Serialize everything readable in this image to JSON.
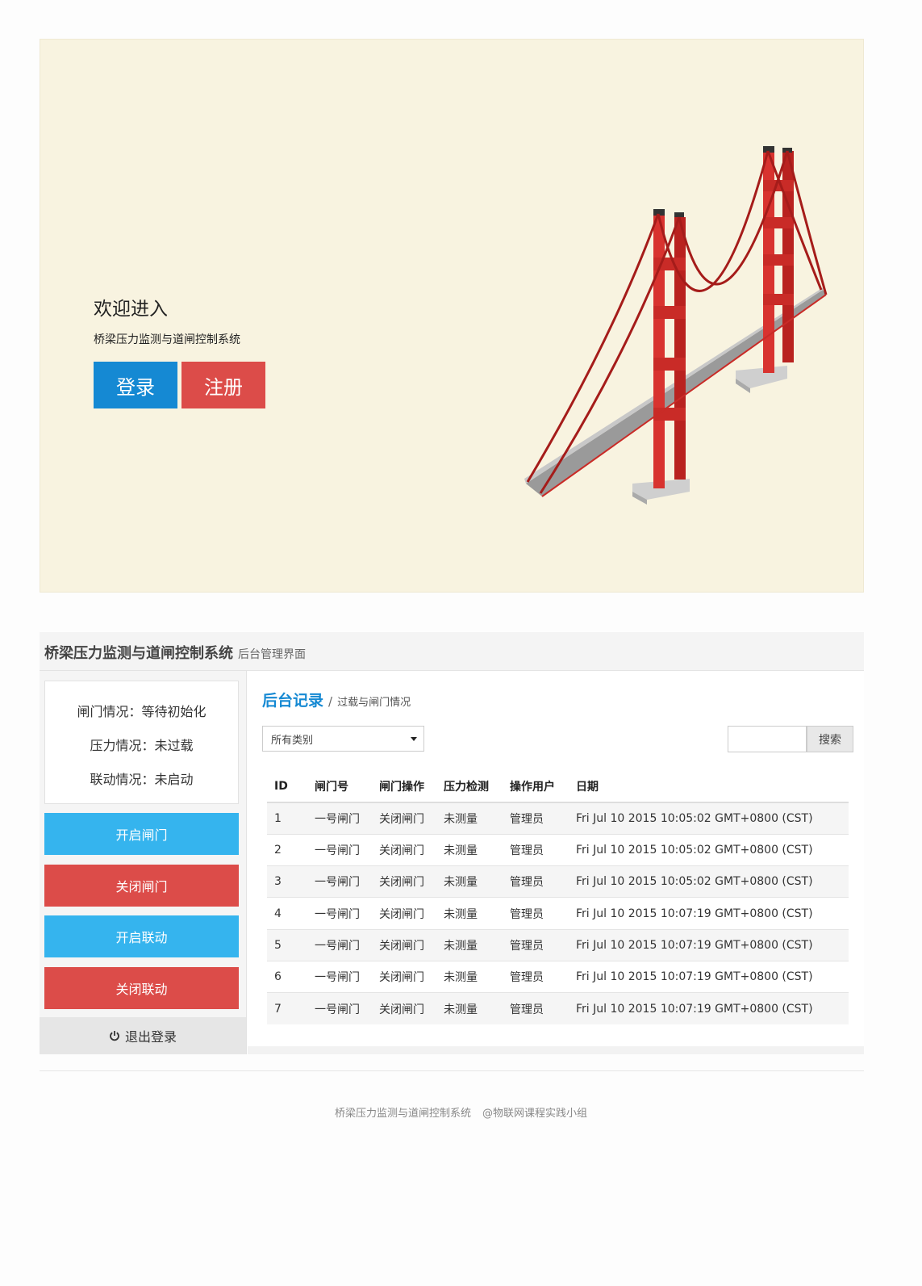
{
  "hero": {
    "title": "欢迎进入",
    "subtitle": "桥梁压力监测与道闸控制系统",
    "login_label": "登录",
    "register_label": "注册"
  },
  "admin": {
    "title": "桥梁压力监测与道闸控制系统",
    "subtitle": "后台管理界面",
    "status": {
      "gate": "闸门情况：等待初始化",
      "pressure": "压力情况：未过载",
      "linkage": "联动情况：未启动"
    },
    "buttons": {
      "open_gate": "开启闸门",
      "close_gate": "关闭闸门",
      "open_linkage": "开启联动",
      "close_linkage": "关闭联动",
      "logout": "退出登录"
    },
    "breadcrumb": {
      "primary": "后台记录",
      "separator": "/",
      "secondary": "过载与闸门情况"
    },
    "filter": {
      "selected": "所有类别"
    },
    "search": {
      "button": "搜索"
    },
    "table": {
      "headers": [
        "ID",
        "闸门号",
        "闸门操作",
        "压力检测",
        "操作用户",
        "日期"
      ],
      "rows": [
        [
          "1",
          "一号闸门",
          "关闭闸门",
          "未测量",
          "管理员",
          "Fri Jul 10 2015 10:05:02 GMT+0800 (CST)"
        ],
        [
          "2",
          "一号闸门",
          "关闭闸门",
          "未测量",
          "管理员",
          "Fri Jul 10 2015 10:05:02 GMT+0800 (CST)"
        ],
        [
          "3",
          "一号闸门",
          "关闭闸门",
          "未测量",
          "管理员",
          "Fri Jul 10 2015 10:05:02 GMT+0800 (CST)"
        ],
        [
          "4",
          "一号闸门",
          "关闭闸门",
          "未测量",
          "管理员",
          "Fri Jul 10 2015 10:07:19 GMT+0800 (CST)"
        ],
        [
          "5",
          "一号闸门",
          "关闭闸门",
          "未测量",
          "管理员",
          "Fri Jul 10 2015 10:07:19 GMT+0800 (CST)"
        ],
        [
          "6",
          "一号闸门",
          "关闭闸门",
          "未测量",
          "管理员",
          "Fri Jul 10 2015 10:07:19 GMT+0800 (CST)"
        ],
        [
          "7",
          "一号闸门",
          "关闭闸门",
          "未测量",
          "管理员",
          "Fri Jul 10 2015 10:07:19 GMT+0800 (CST)"
        ]
      ]
    }
  },
  "footer": {
    "system": "桥梁压力监测与道闸控制系统",
    "credit": "@物联网课程实践小组"
  },
  "icons": {
    "bridge": "bridge-illustration",
    "power": "power-icon",
    "caret": "caret-down-icon"
  },
  "colors": {
    "primary_blue": "#1589d3",
    "light_blue": "#35b4ee",
    "red": "#dc4c49",
    "hero_bg": "#f8f3e0"
  }
}
